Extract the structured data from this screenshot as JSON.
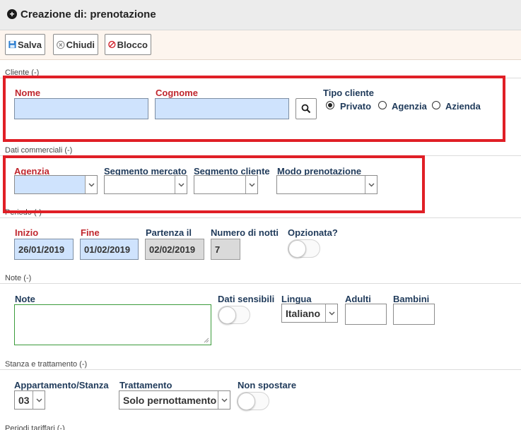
{
  "window": {
    "title": "Creazione di: prenotazione"
  },
  "toolbar": {
    "save_label": "Salva",
    "close_label": "Chiudi",
    "block_label": "Blocco"
  },
  "cliente": {
    "section_title": "Cliente (-)",
    "nome_label": "Nome",
    "nome_value": "",
    "cognome_label": "Cognome",
    "cognome_value": "",
    "tipo_label": "Tipo cliente",
    "options": [
      "Privato",
      "Agenzia",
      "Azienda"
    ],
    "selected": "Privato"
  },
  "dati_commerciali": {
    "section_title": "Dati commerciali (-)",
    "agenzia_label": "Agenzia",
    "agenzia_value": "",
    "segmento_mercato_label": "Segmento mercato",
    "segmento_mercato_value": "",
    "segmento_cliente_label": "Segmento cliente",
    "segmento_cliente_value": "",
    "modo_prenotazione_label": "Modo prenotazione",
    "modo_prenotazione_value": ""
  },
  "periodo": {
    "section_title": "Periodo (-)",
    "inizio_label": "Inizio",
    "inizio_value": "26/01/2019",
    "fine_label": "Fine",
    "fine_value": "01/02/2019",
    "partenza_label": "Partenza il",
    "partenza_value": "02/02/2019",
    "notti_label": "Numero di notti",
    "notti_value": "7",
    "opzionata_label": "Opzionata?",
    "opzionata_on": false
  },
  "note": {
    "section_title": "Note (-)",
    "note_label": "Note",
    "note_value": "",
    "dati_sensibili_label": "Dati sensibili",
    "dati_sensibili_on": false,
    "lingua_label": "Lingua",
    "lingua_value": "Italiano",
    "adulti_label": "Adulti",
    "adulti_value": "",
    "bambini_label": "Bambini",
    "bambini_value": ""
  },
  "stanza": {
    "section_title": "Stanza e trattamento (-)",
    "appartamento_label": "Appartamento/Stanza",
    "appartamento_value": "03",
    "trattamento_label": "Trattamento",
    "trattamento_value": "Solo pernottamento",
    "non_spostare_label": "Non spostare",
    "non_spostare_on": false
  },
  "periodi_tariffari": {
    "section_title": "Periodi tariffari (-)"
  },
  "colors": {
    "required": "#c0262d",
    "label": "#1f3a5a",
    "highlight": "#e01f26",
    "input_blue": "#cfe3fd"
  }
}
